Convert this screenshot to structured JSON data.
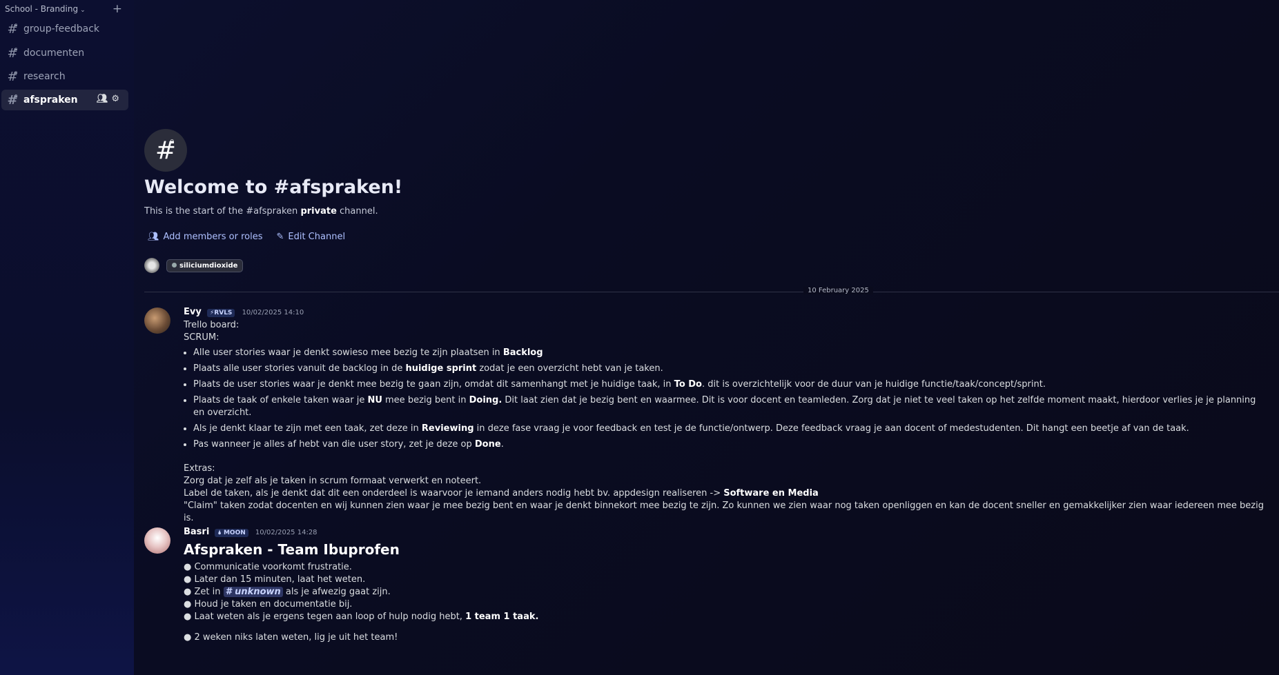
{
  "sidebar": {
    "server_name": "School - Branding",
    "channels": [
      {
        "label": "group-feedback"
      },
      {
        "label": "documenten"
      },
      {
        "label": "research"
      },
      {
        "label": "afspraken",
        "active": true
      }
    ]
  },
  "welcome": {
    "title": "Welcome to #afspraken!",
    "sub_pre": "This is the start of the #afspraken ",
    "sub_bold": "private",
    "sub_post": " channel.",
    "add_members": "Add members or roles",
    "edit_channel": "Edit Channel",
    "member_chip": "siliciumdioxide"
  },
  "divider_date": "10 February 2025",
  "messages": {
    "evy": {
      "author": "Evy",
      "tag": "⚡RVLS",
      "time": "10/02/2025 14:10",
      "l1": "Trello board:",
      "l2": "SCRUM:",
      "b1_pre": "Alle user stories waar je denkt sowieso mee bezig te zijn plaatsen in ",
      "b1_bold": "Backlog",
      "b2_pre": "Plaats alle user stories vanuit de backlog in de ",
      "b2_bold": "huidige sprint",
      "b2_post": " zodat je een overzicht hebt van je taken.",
      "b3_pre": "Plaats de user stories waar je denkt mee bezig te gaan zijn, omdat dit samenhangt met je huidige taak, in ",
      "b3_bold": "To Do",
      "b3_post": ". dit is overzichtelijk voor de duur van je huidige functie/taak/concept/sprint.",
      "b4_pre": "Plaats de taak of enkele taken waar je ",
      "b4_bold1": "NU",
      "b4_mid": " mee bezig bent in ",
      "b4_bold2": "Doing.",
      "b4_post": " Dit laat zien dat je bezig bent en waarmee. Dit is voor docent en teamleden. Zorg dat je niet te veel taken op het zelfde moment maakt, hierdoor verlies je je planning en overzicht.",
      "b5_pre": "Als je denkt klaar te zijn met een taak, zet deze in ",
      "b5_bold": "Reviewing",
      "b5_post": " in deze fase vraag je voor feedback en test je de functie/ontwerp. Deze feedback vraag je aan docent of medestudenten. Dit hangt een beetje af van de taak.",
      "b6_pre": "Pas wanneer je alles af hebt van die user story, zet je deze op ",
      "b6_bold": "Done",
      "b6_post": ".",
      "extras": "Extras:",
      "e1": "Zorg dat je zelf als je taken in scrum formaat verwerkt en noteert.",
      "e2_pre": "Label de taken, als je denkt dat dit een onderdeel is waarvoor je iemand anders nodig hebt bv. appdesign realiseren -> ",
      "e2_bold": "Software en Media",
      "e3": "\"Claim\" taken zodat docenten en wij kunnen zien waar je mee bezig bent en waar je denkt binnekort mee bezig te zijn. Zo kunnen we zien waar nog taken openliggen en kan de docent sneller en gemakkelijker zien waar iedereen mee bezig is."
    },
    "basri": {
      "author": "Basri",
      "tag": "🌢 MOON",
      "time": "10/02/2025 14:28",
      "heading": "Afspraken - Team Ibuprofen",
      "p1": "● Communicatie voorkomt frustratie.",
      "p2": "● Later dan 15 minuten, laat het weten.",
      "p3_pre": "● Zet in ",
      "p3_mention": "# unknown",
      "p3_post": " als je afwezig gaat zijn.",
      "p4": "● Houd je taken en documentatie bij.",
      "p5_pre": "● Laat weten als je ergens tegen aan loop of hulp nodig hebt, ",
      "p5_bold": "1 team 1 taak.",
      "p6": "● 2 weken niks laten weten, lig je uit het team!"
    }
  }
}
